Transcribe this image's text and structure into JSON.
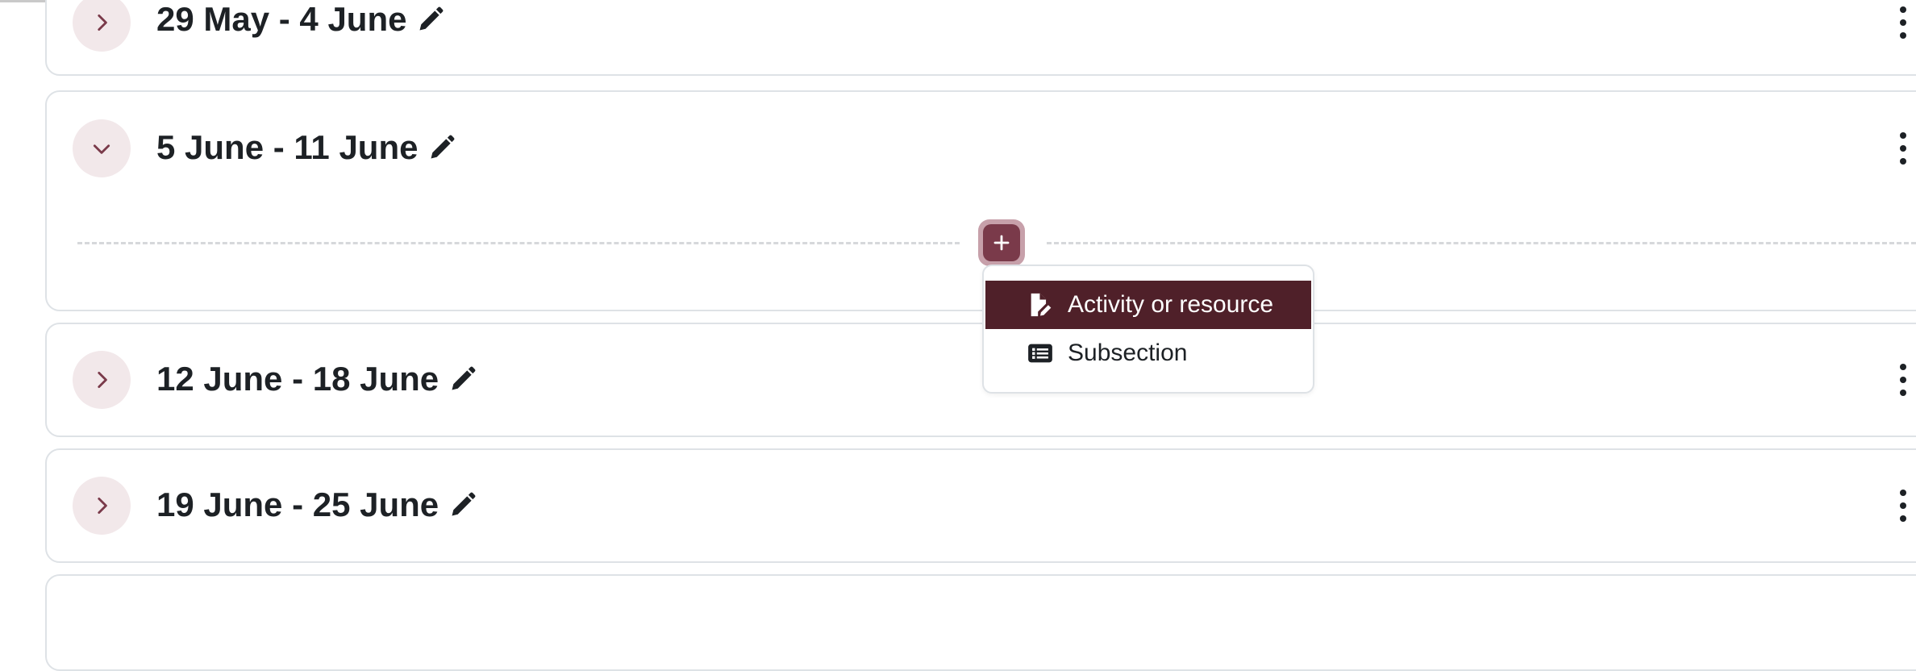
{
  "sections": [
    {
      "title": "29 May - 4 June",
      "expanded": false
    },
    {
      "title": "5 June - 11 June",
      "expanded": true
    },
    {
      "title": "12 June - 18 June",
      "expanded": false
    },
    {
      "title": "19 June - 25 June",
      "expanded": false
    }
  ],
  "add_menu": {
    "items": [
      {
        "label": "Activity or resource",
        "icon": "file-pen-icon",
        "active": true
      },
      {
        "label": "Subsection",
        "icon": "list-icon",
        "active": false
      }
    ]
  },
  "colors": {
    "accent": "#7a3a4a",
    "active_item_bg": "#4f2029",
    "toggle_bg": "#f2e8ea"
  }
}
